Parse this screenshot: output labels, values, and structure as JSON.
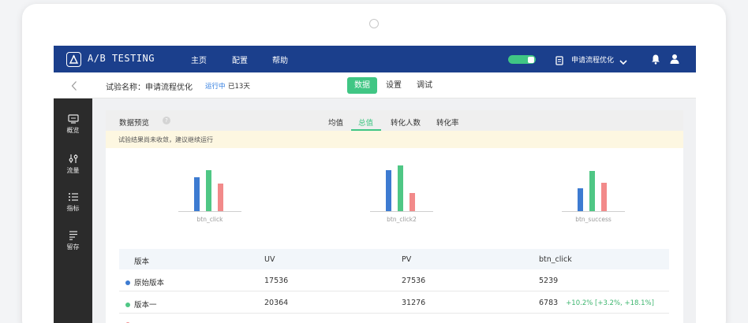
{
  "app": {
    "brand": "A/B TESTING",
    "nav": [
      "主页",
      "配置",
      "帮助"
    ],
    "experiment_selector": "申请流程优化"
  },
  "subbar": {
    "experiment_label": "试验名称：申请流程优化",
    "status": "运行中",
    "days": "已13天",
    "tabs": [
      "数据",
      "设置",
      "调试"
    ],
    "active_tab": "数据"
  },
  "sidebar": {
    "items": [
      {
        "label": "概览",
        "icon": "monitor-icon"
      },
      {
        "label": "流量",
        "icon": "traffic-icon"
      },
      {
        "label": "指标",
        "icon": "list-icon"
      },
      {
        "label": "留存",
        "icon": "retention-icon"
      }
    ]
  },
  "panel": {
    "title": "数据预览",
    "help_icon": "?",
    "metric_tabs": [
      "均值",
      "总值",
      "转化人数",
      "转化率"
    ],
    "active_metric": "总值",
    "warning": "试验结果尚未收敛，建议继续运行"
  },
  "colors": {
    "brand_blue": "#1b3f8c",
    "accent_green": "#40c684",
    "series_blue": "#3d7bd1",
    "series_green": "#4fc785",
    "series_red": "#f28a8a",
    "delta_green": "#3db56e"
  },
  "chart_data": [
    {
      "type": "bar",
      "xlabel": "btn_click",
      "series": [
        {
          "values": [
            43
          ]
        },
        {
          "values": [
            52
          ]
        },
        {
          "values": [
            35
          ]
        }
      ]
    },
    {
      "type": "bar",
      "xlabel": "btn_click2",
      "series": [
        {
          "values": [
            52
          ]
        },
        {
          "values": [
            58
          ]
        },
        {
          "values": [
            23
          ]
        }
      ]
    },
    {
      "type": "bar",
      "xlabel": "btn_success",
      "series": [
        {
          "values": [
            29
          ]
        },
        {
          "values": [
            51
          ]
        },
        {
          "values": [
            36
          ]
        }
      ]
    }
  ],
  "table": {
    "columns": [
      "版本",
      "UV",
      "PV",
      "btn_click"
    ],
    "rows": [
      {
        "version": "原始版本",
        "uv": "17536",
        "pv": "27536",
        "btn_click": "5239",
        "delta": ""
      },
      {
        "version": "版本一",
        "uv": "20364",
        "pv": "31276",
        "btn_click": "6783",
        "delta": "+10.2% [+3.2%, +18.1%]"
      }
    ]
  }
}
